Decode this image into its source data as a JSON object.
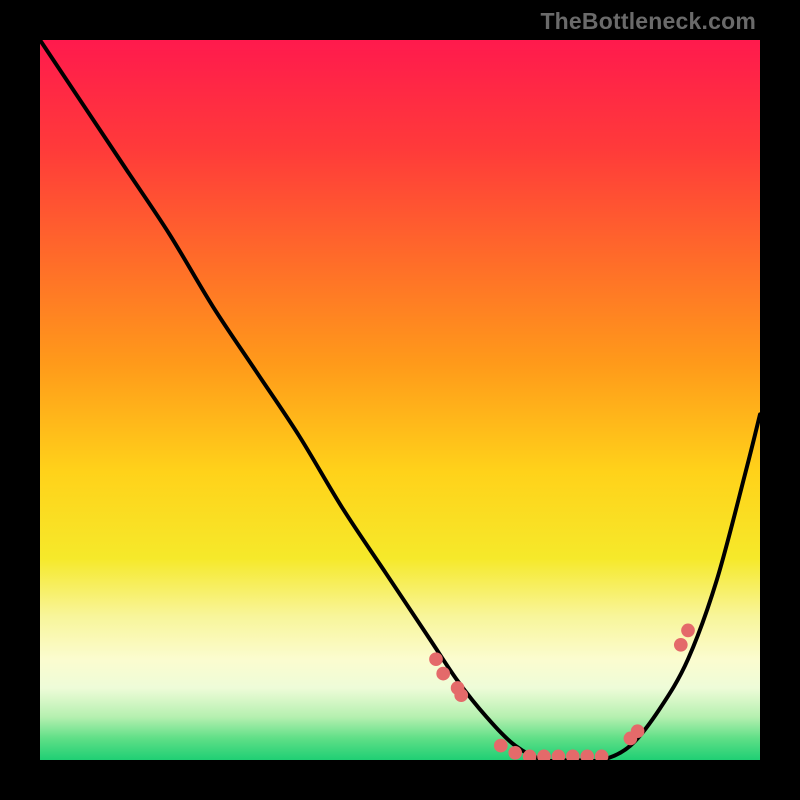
{
  "watermark": "TheBottleneck.com",
  "chart_data": {
    "type": "line",
    "title": "",
    "xlabel": "",
    "ylabel": "",
    "xlim": [
      0,
      100
    ],
    "ylim": [
      0,
      100
    ],
    "grid": false,
    "legend": false,
    "series": [
      {
        "name": "curve",
        "x": [
          0,
          6,
          12,
          18,
          24,
          30,
          36,
          42,
          48,
          54,
          58,
          62,
          66,
          70,
          74,
          78,
          82,
          86,
          90,
          94,
          98,
          100
        ],
        "y": [
          100,
          91,
          82,
          73,
          63,
          54,
          45,
          35,
          26,
          17,
          11,
          6,
          2,
          0,
          0,
          0,
          2,
          7,
          14,
          25,
          40,
          48
        ]
      }
    ],
    "scatter_points": {
      "name": "markers",
      "x": [
        55,
        56,
        58,
        58.5,
        64,
        66,
        68,
        70,
        72,
        74,
        76,
        78,
        82,
        83,
        89,
        90
      ],
      "y": [
        14,
        12,
        10,
        9,
        2,
        1,
        0.5,
        0.5,
        0.5,
        0.5,
        0.5,
        0.5,
        3,
        4,
        16,
        18
      ]
    },
    "gradient_stops": [
      {
        "offset": 0.0,
        "color": "#ff1a4d"
      },
      {
        "offset": 0.15,
        "color": "#ff3a3a"
      },
      {
        "offset": 0.3,
        "color": "#ff6a2a"
      },
      {
        "offset": 0.45,
        "color": "#ff9a1a"
      },
      {
        "offset": 0.6,
        "color": "#ffd21a"
      },
      {
        "offset": 0.72,
        "color": "#f6e92a"
      },
      {
        "offset": 0.8,
        "color": "#f8f59a"
      },
      {
        "offset": 0.86,
        "color": "#fbfccf"
      },
      {
        "offset": 0.9,
        "color": "#eefcd8"
      },
      {
        "offset": 0.94,
        "color": "#b6f0b0"
      },
      {
        "offset": 0.97,
        "color": "#5fdf87"
      },
      {
        "offset": 1.0,
        "color": "#1fcf74"
      }
    ]
  }
}
